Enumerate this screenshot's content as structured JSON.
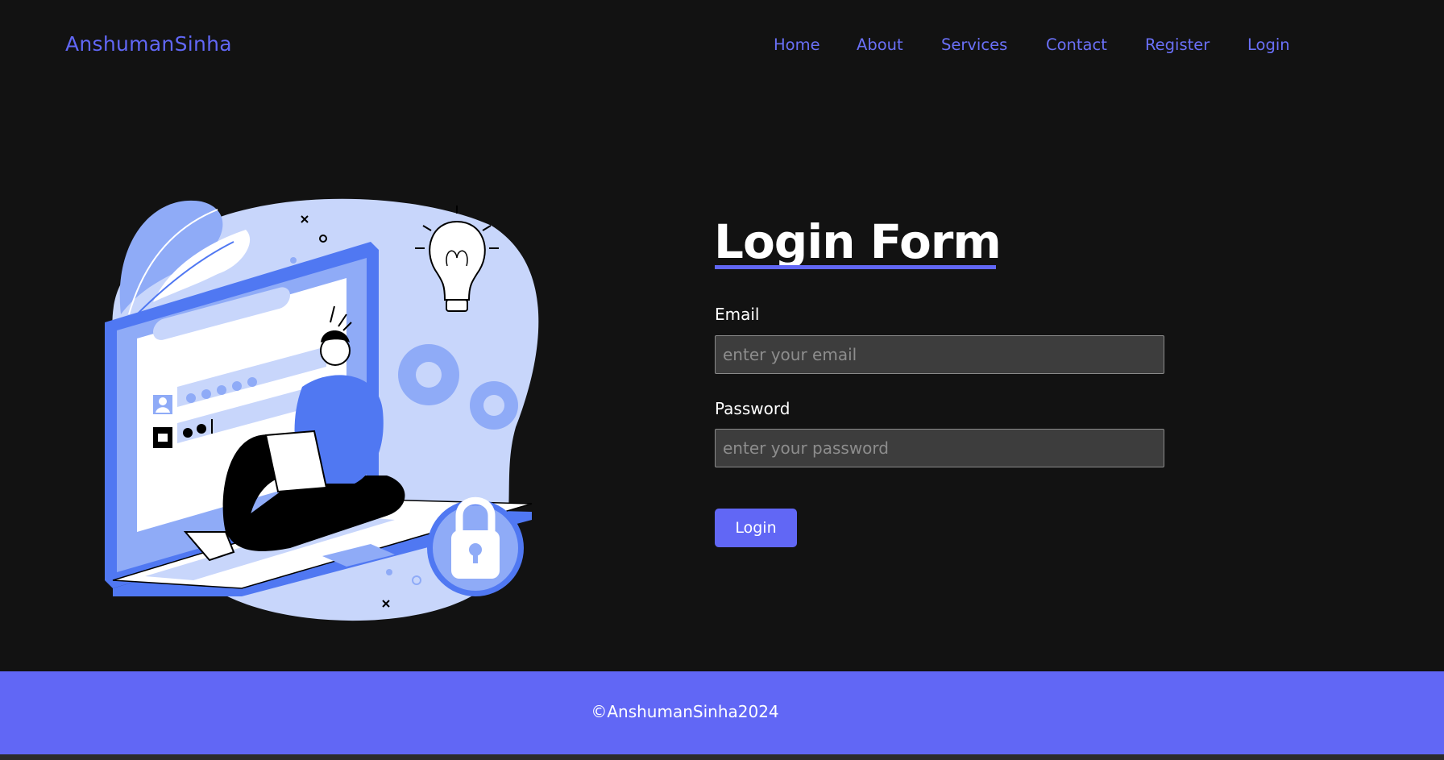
{
  "brand": "AnshumanSinha",
  "nav": {
    "items": [
      "Home",
      "About",
      "Services",
      "Contact",
      "Register",
      "Login"
    ]
  },
  "form": {
    "title": "Login Form",
    "email_label": "Email",
    "email_placeholder": "enter your email",
    "password_label": "Password",
    "password_placeholder": "enter your password",
    "submit_label": "Login"
  },
  "footer": {
    "text": "©AnshumanSinha2024"
  },
  "colors": {
    "accent": "#6167f5",
    "background": "#121212",
    "input_bg": "#3d3d3d",
    "illustration_light": "#c8d6fb",
    "illustration_mid": "#8fabf7",
    "illustration_dark": "#5078f2"
  },
  "icons": [
    "lightbulb-icon",
    "gear-icon",
    "padlock-icon",
    "user-icon",
    "lock-icon"
  ]
}
